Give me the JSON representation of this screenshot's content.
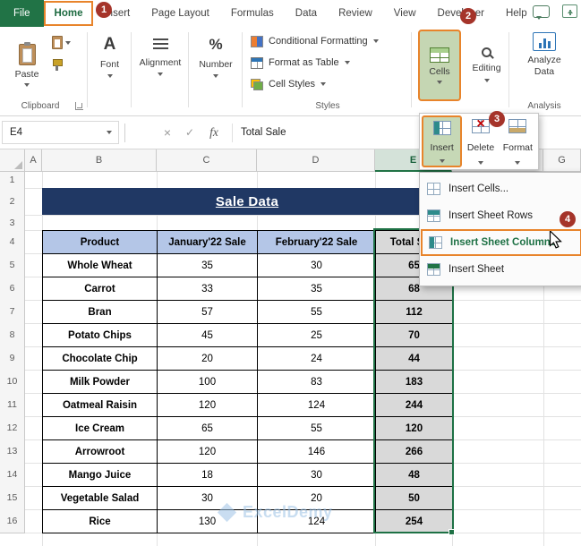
{
  "menu": {
    "tabs": [
      {
        "label": "File",
        "state": "file"
      },
      {
        "label": "Home",
        "state": "active"
      },
      {
        "label": "Insert",
        "state": "normal"
      },
      {
        "label": "Page Layout",
        "state": "normal"
      },
      {
        "label": "Formulas",
        "state": "normal"
      },
      {
        "label": "Data",
        "state": "normal"
      },
      {
        "label": "Review",
        "state": "normal"
      },
      {
        "label": "View",
        "state": "normal"
      },
      {
        "label": "Developer",
        "state": "normal"
      },
      {
        "label": "Help",
        "state": "normal"
      }
    ]
  },
  "ribbon": {
    "paste_label": "Paste",
    "clipboard_group_label": "Clipboard",
    "font_group_label": "Font",
    "alignment_group_label": "Alignment",
    "number_group_label": "Number",
    "styles_items": [
      "Conditional Formatting",
      "Format as Table",
      "Cell Styles"
    ],
    "styles_group_label": "Styles",
    "cells_label": "Cells",
    "editing_label": "Editing",
    "analyze_data_label": "Analyze Data",
    "analysis_group_label": "Analysis"
  },
  "icons_text": {
    "font_glyph": "A",
    "percent_glyph": "%",
    "cancel_glyph": "×",
    "enter_glyph": "✓",
    "fx_glyph": "fx",
    "delete_glyph": "×"
  },
  "formula_bar": {
    "name_box": "E4",
    "value": "Total Sale"
  },
  "cells_dropdown": {
    "buttons": [
      {
        "label": "Insert",
        "highlighted": true
      },
      {
        "label": "Delete",
        "highlighted": false
      },
      {
        "label": "Format",
        "highlighted": false
      }
    ]
  },
  "insert_menu": {
    "items": [
      {
        "label": "Insert Cells...",
        "icon": "insert-cells-icon",
        "highlighted": false
      },
      {
        "label": "Insert Sheet Rows",
        "icon": "insert-sheet-rows-icon",
        "highlighted": false
      },
      {
        "label": "Insert Sheet Columns",
        "icon": "insert-sheet-columns-icon",
        "highlighted": true
      },
      {
        "label": "Insert Sheet",
        "icon": "insert-sheet-icon",
        "highlighted": false
      }
    ]
  },
  "annotations": {
    "step1": "1",
    "step2": "2",
    "step3": "3",
    "step4": "4"
  },
  "sheet": {
    "visible_columns": [
      "A",
      "B",
      "C",
      "D",
      "E",
      "G"
    ],
    "visible_rows": [
      "1",
      "2",
      "3",
      "4",
      "5",
      "6",
      "7",
      "8",
      "9",
      "10",
      "11",
      "12",
      "13",
      "14",
      "15",
      "16"
    ],
    "title": "Sale Data",
    "table_headers": [
      "Product",
      "January'22 Sale",
      "February'22 Sale",
      "Total Sale"
    ],
    "table_rows": [
      [
        "Whole Wheat",
        "35",
        "30",
        "65"
      ],
      [
        "Carrot",
        "33",
        "35",
        "68"
      ],
      [
        "Bran",
        "57",
        "55",
        "112"
      ],
      [
        "Potato Chips",
        "45",
        "25",
        "70"
      ],
      [
        "Chocolate Chip",
        "20",
        "24",
        "44"
      ],
      [
        "Milk Powder",
        "100",
        "83",
        "183"
      ],
      [
        "Oatmeal Raisin",
        "120",
        "124",
        "244"
      ],
      [
        "Ice Cream",
        "65",
        "55",
        "120"
      ],
      [
        "Arrowroot",
        "120",
        "146",
        "266"
      ],
      [
        "Mango Juice",
        "18",
        "30",
        "48"
      ],
      [
        "Vegetable Salad",
        "30",
        "20",
        "50"
      ],
      [
        "Rice",
        "130",
        "124",
        "254"
      ]
    ],
    "selected_column": "E",
    "active_cell": "E4"
  },
  "watermark": {
    "text": "ExcelDemy"
  },
  "colors": {
    "excel_green": "#217346",
    "title_bg": "#203864",
    "table_header_bg": "#B4C6E7",
    "selection_fill": "#D9D9D9",
    "highlight_orange": "#E8842B",
    "annotation_red": "#A5342A"
  }
}
